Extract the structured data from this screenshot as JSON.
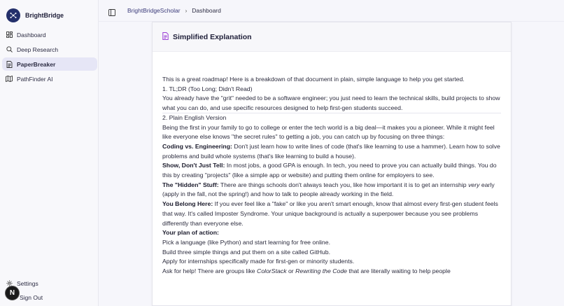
{
  "app": {
    "brand": "BrightBridge"
  },
  "sidebar": {
    "items": [
      {
        "label": "Dashboard",
        "icon": "dashboard-icon",
        "active": false
      },
      {
        "label": "Deep Research",
        "icon": "search-icon",
        "active": false
      },
      {
        "label": "PaperBreaker",
        "icon": "document-icon",
        "active": true
      },
      {
        "label": "PathFinder AI",
        "icon": "map-icon",
        "active": false
      }
    ],
    "settings_label": "Settings",
    "signout_label": "Sign Out",
    "badge": "N"
  },
  "header": {
    "breadcrumb": [
      "BrightBridgeScholar",
      "Dashboard"
    ]
  },
  "card": {
    "title": "Simplified Explanation",
    "intro": "This is a great roadmap! Here is a breakdown of that document in plain, simple language to help you get started.",
    "s1_heading": "1. TL;DR (Too Long; Didn't Read)",
    "s1_text": "You already have the \"grit\" needed to be a software engineer; you just need to learn the technical skills, build projects to show what you can do, and use specific resources designed to help first-gen students succeed.",
    "s2_heading": "2. Plain English Version",
    "s2_text": "Being the first in your family to go to college or enter the tech world is a big deal—it makes you a pioneer. While it might feel like everyone else knows \"the secret rules\" to getting a job, you can catch up by focusing on three things:",
    "p1_bold": "Coding vs. Engineering:",
    "p1_text": " Don't just learn how to write lines of code (that's like learning to use a hammer). Learn how to solve problems and build whole systems (that's like learning to build a house).",
    "p2_bold": "Show, Don't Just Tell:",
    "p2_text": " In most jobs, a good GPA is enough. In tech, you need to prove you can actually build things. You do this by creating \"projects\" (like a simple app or website) and putting them online for employers to see.",
    "p3_bold": "The \"Hidden\" Stuff:",
    "p3_text_a": " There are things schools don't always teach you, like how important it is to get an internship ",
    "p3_em": "very",
    "p3_text_b": " early (apply in the fall, not the spring!) and how to talk to people already working in the field.",
    "p4_bold": "You Belong Here:",
    "p4_text": " If you ever feel like a \"fake\" or like you aren't smart enough, know that almost every first-gen student feels that way. It's called Imposter Syndrome. Your unique background is actually a superpower because you see problems differently than everyone else.",
    "plan_heading": "Your plan of action:",
    "plan_1": "Pick a language (like Python) and start learning for free online.",
    "plan_2": "Build three simple things and put them on a site called GitHub.",
    "plan_3": "Apply for internships specifically made for first-gen or minority students.",
    "plan_4_a": "Ask for help! There are groups like ",
    "plan_4_em1": "ColorStack",
    "plan_4_or": " or ",
    "plan_4_em2": "Rewriting the Code",
    "plan_4_b": " that are literally waiting to help people"
  }
}
